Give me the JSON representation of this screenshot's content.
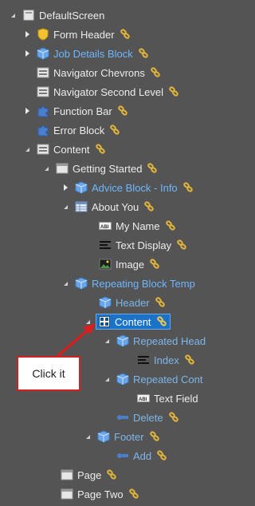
{
  "tree": {
    "items": [
      {
        "label": "DefaultScreen"
      },
      {
        "label": "Form Header"
      },
      {
        "label": "Job Details Block"
      },
      {
        "label": "Navigator Chevrons"
      },
      {
        "label": "Navigator Second Level"
      },
      {
        "label": "Function Bar"
      },
      {
        "label": "Error Block"
      },
      {
        "label": "Content"
      },
      {
        "label": "Getting Started"
      },
      {
        "label": "Advice Block - Info"
      },
      {
        "label": "About You"
      },
      {
        "label": "My Name"
      },
      {
        "label": "Text Display"
      },
      {
        "label": "Image"
      },
      {
        "label": "Repeating Block Temp"
      },
      {
        "label": "Header"
      },
      {
        "label": "Content"
      },
      {
        "label": "Repeated Head"
      },
      {
        "label": "Index"
      },
      {
        "label": "Repeated Cont"
      },
      {
        "label": "Text Field"
      },
      {
        "label": "Delete"
      },
      {
        "label": "Footer"
      },
      {
        "label": "Add"
      },
      {
        "label": "Page"
      },
      {
        "label": "Page Two"
      }
    ]
  },
  "callout": {
    "text": "Click it"
  },
  "colors": {
    "background": "#545454",
    "accent_text": "#6fb6ff",
    "selection": "#1a73c9",
    "callout_border": "#d32020"
  }
}
